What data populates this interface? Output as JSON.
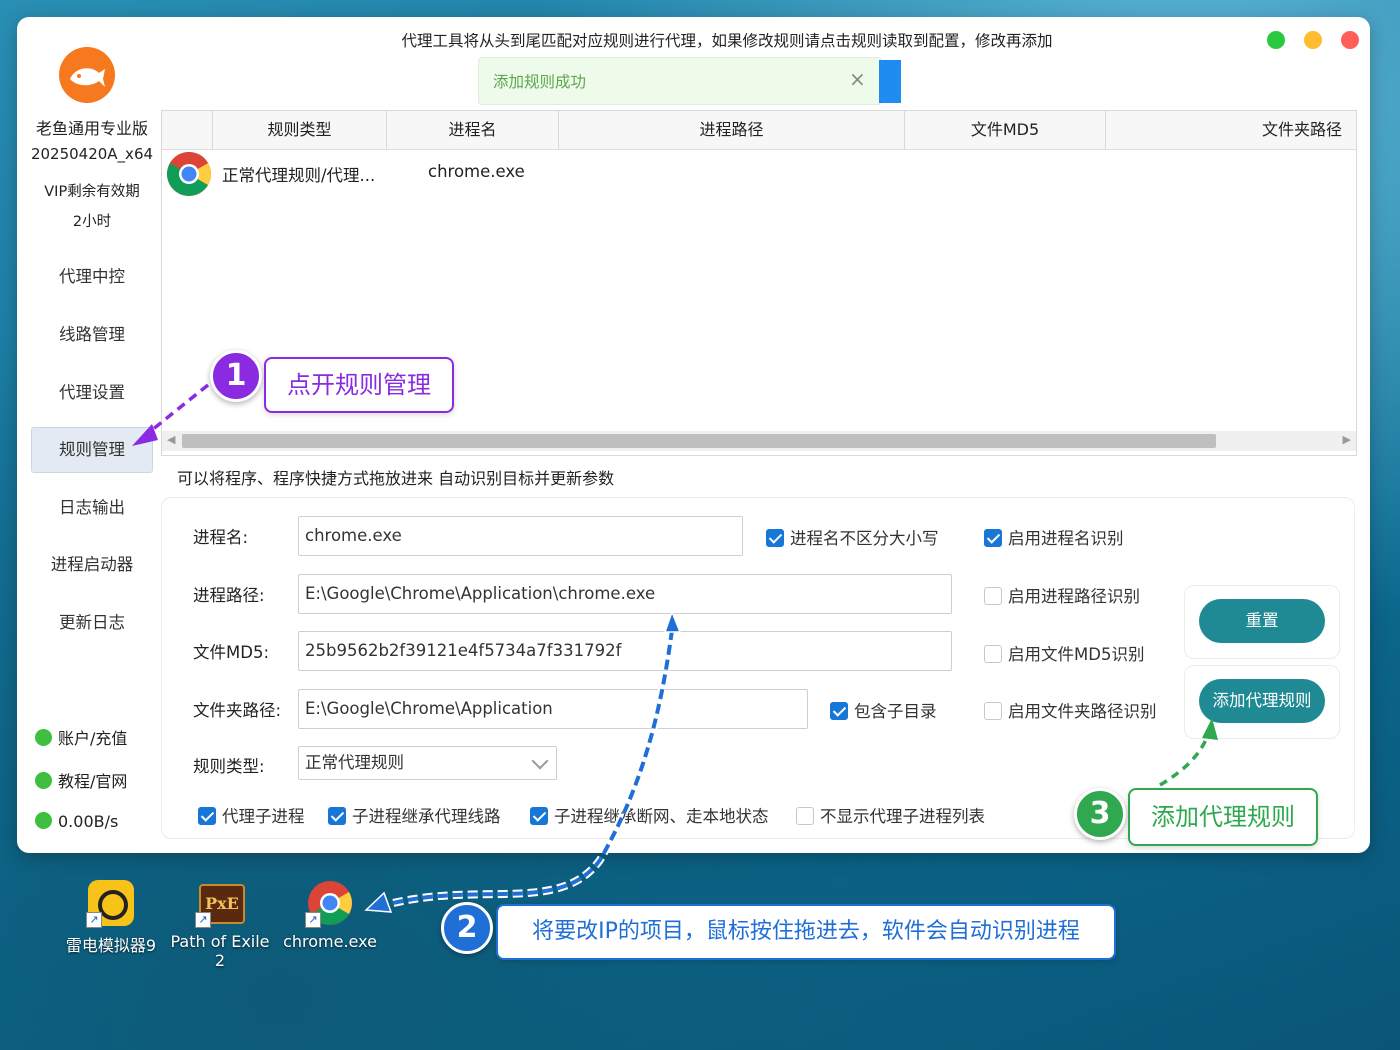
{
  "window": {
    "title_hint": "代理工具将从头到尾匹配对应规则进行代理，如果修改规则请点击规则读取到配置，修改再添加"
  },
  "toast": {
    "message": "添加规则成功",
    "close": "×"
  },
  "sidebar": {
    "app_name": "老鱼通用专业版",
    "version": "20250420A_x64",
    "vip_label": "VIP剩余有效期",
    "vip_time": "2小时",
    "nav": [
      {
        "label": "代理中控"
      },
      {
        "label": "线路管理"
      },
      {
        "label": "代理设置"
      },
      {
        "label": "规则管理",
        "active": true
      },
      {
        "label": "日志输出"
      },
      {
        "label": "进程启动器"
      },
      {
        "label": "更新日志"
      }
    ],
    "status": [
      {
        "label": "账户/充值"
      },
      {
        "label": "教程/官网"
      },
      {
        "label": "0.00B/s"
      }
    ]
  },
  "rules_table": {
    "columns": [
      "规则类型",
      "进程名",
      "进程路径",
      "文件MD5",
      "文件夹路径"
    ],
    "rows": [
      {
        "type": "正常代理规则/代理...",
        "process": "chrome.exe"
      }
    ]
  },
  "drag_hint": "可以将程序、程序快捷方式拖放进来 自动识别目标并更新参数",
  "form": {
    "process_name_label": "进程名:",
    "process_name_value": "chrome.exe",
    "process_path_label": "进程路径:",
    "process_path_value": "E:\\Google\\Chrome\\Application\\chrome.exe",
    "md5_label": "文件MD5:",
    "md5_value": "25b9562b2f39121e4f5734a7f331792f",
    "folder_label": "文件夹路径:",
    "folder_value": "E:\\Google\\Chrome\\Application",
    "rule_type_label": "规则类型:",
    "rule_type_value": "正常代理规则",
    "checkboxes": {
      "case_insensitive": {
        "label": "进程名不区分大小写",
        "checked": true
      },
      "enable_name": {
        "label": "启用进程名识别",
        "checked": true
      },
      "enable_path": {
        "label": "启用进程路径识别",
        "checked": false
      },
      "enable_md5": {
        "label": "启用文件MD5识别",
        "checked": false
      },
      "include_sub": {
        "label": "包含子目录",
        "checked": true
      },
      "enable_folder": {
        "label": "启用文件夹路径识别",
        "checked": false
      },
      "proxy_child": {
        "label": "代理子进程",
        "checked": true
      },
      "inherit_line": {
        "label": "子进程继承代理线路",
        "checked": true
      },
      "inherit_state": {
        "label": "子进程继承断网、走本地状态",
        "checked": true
      },
      "hide_child_list": {
        "label": "不显示代理子进程列表",
        "checked": false
      }
    },
    "reset_button": "重置",
    "add_button": "添加代理规则"
  },
  "annotations": [
    {
      "number": "1",
      "text": "点开规则管理",
      "color": "#8a2be2"
    },
    {
      "number": "2",
      "text": "将要改IP的项目，鼠标按住拖进去，软件会自动识别进程",
      "color": "#1f6fd6"
    },
    {
      "number": "3",
      "text": "添加代理规则",
      "color": "#2fa84f"
    }
  ],
  "desktop_icons": [
    {
      "label": "雷电模拟器9",
      "icon": "ldplayer-icon"
    },
    {
      "label": "Path of Exile 2",
      "icon": "poe2-icon"
    },
    {
      "label": "chrome.exe",
      "icon": "chrome-icon"
    }
  ],
  "colors": {
    "accent_button": "#1f8a94",
    "checkbox": "#1677d6",
    "toast_bg": "#eefaea",
    "toast_text": "#5aa84b",
    "logo": "#f6791f"
  }
}
